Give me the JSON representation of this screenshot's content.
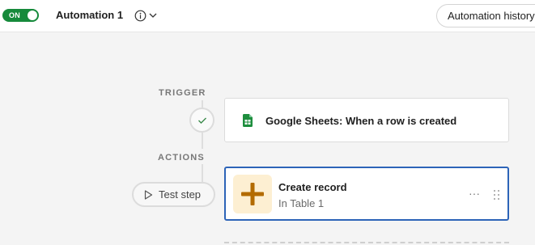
{
  "topbar": {
    "toggle_label": "ON",
    "automation_title": "Automation 1",
    "history_button": "Automation history"
  },
  "flow": {
    "trigger_label": "TRIGGER",
    "actions_label": "ACTIONS",
    "test_step_label": "Test step",
    "trigger": {
      "text": "Google Sheets: When a row is created",
      "icon": "google-sheets-icon"
    },
    "action": {
      "title": "Create record",
      "subtitle": "In Table 1",
      "icon": "plus-icon",
      "more": "···"
    }
  },
  "colors": {
    "toggle_on": "#168a3b",
    "selected_border": "#2d64b8",
    "plus_tile_bg": "#fdefd2",
    "plus_color": "#b36b00",
    "sheets_green": "#1e8e3e"
  }
}
